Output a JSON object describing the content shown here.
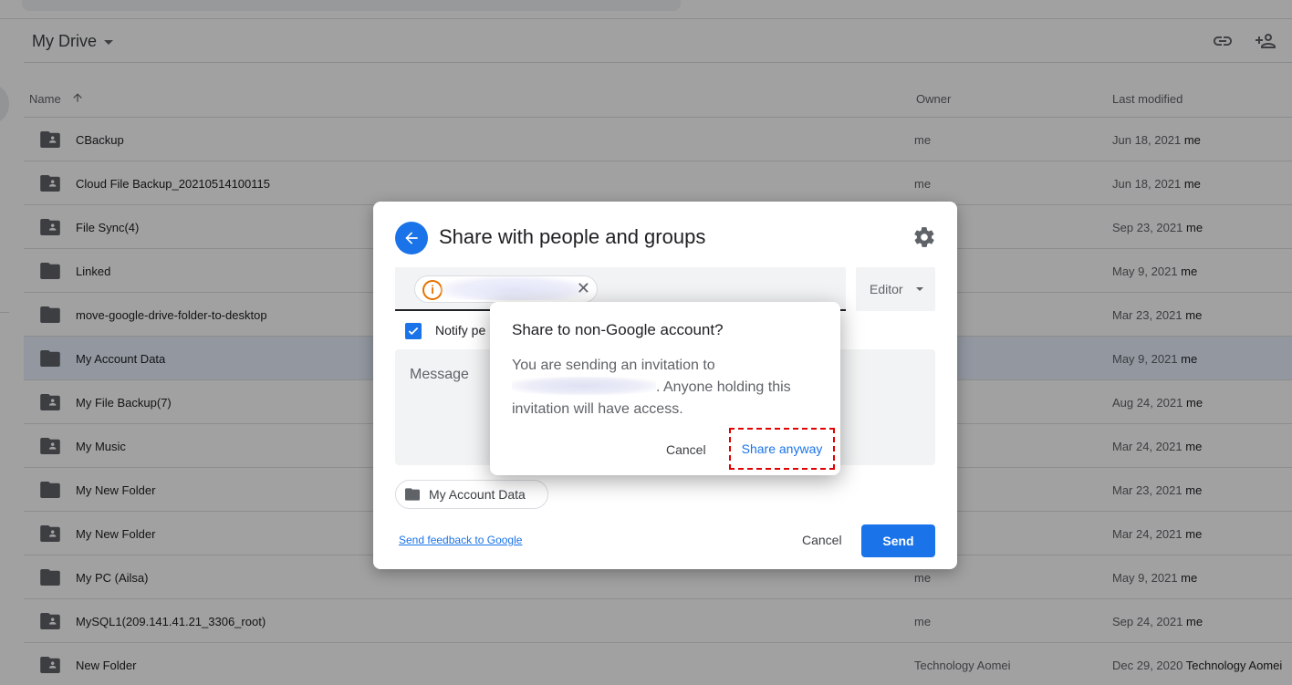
{
  "drive": {
    "title": "My Drive",
    "columns": {
      "name": "Name",
      "owner": "Owner",
      "modified": "Last modified"
    },
    "rows": [
      {
        "name": "CBackup",
        "owner": "me",
        "date": "Jun 18, 2021",
        "by": "me",
        "shared": true
      },
      {
        "name": "Cloud File Backup_20210514100115",
        "owner": "me",
        "date": "Jun 18, 2021",
        "by": "me",
        "shared": true
      },
      {
        "name": "File Sync(4)",
        "owner": "",
        "date": "Sep 23, 2021",
        "by": "me",
        "shared": true
      },
      {
        "name": "Linked",
        "owner": "",
        "date": "May 9, 2021",
        "by": "me",
        "shared": false
      },
      {
        "name": "move-google-drive-folder-to-desktop",
        "owner": "",
        "date": "Mar 23, 2021",
        "by": "me",
        "shared": false
      },
      {
        "name": "My Account Data",
        "owner": "",
        "date": "May 9, 2021",
        "by": "me",
        "shared": false,
        "selected": true
      },
      {
        "name": "My File Backup(7)",
        "owner": "",
        "date": "Aug 24, 2021",
        "by": "me",
        "shared": true
      },
      {
        "name": "My Music",
        "owner": "",
        "date": "Mar 24, 2021",
        "by": "me",
        "shared": true
      },
      {
        "name": "My New Folder",
        "owner": "",
        "date": "Mar 23, 2021",
        "by": "me",
        "shared": false
      },
      {
        "name": "My New Folder",
        "owner": "",
        "date": "Mar 24, 2021",
        "by": "me",
        "shared": true
      },
      {
        "name": "My PC (Ailsa)",
        "owner": "me",
        "date": "May 9, 2021",
        "by": "me",
        "shared": false
      },
      {
        "name": "MySQL1(209.141.41.21_3306_root)",
        "owner": "me",
        "date": "Sep 24, 2021",
        "by": "me",
        "shared": true
      },
      {
        "name": "New Folder",
        "owner": "Technology Aomei",
        "date": "Dec 29, 2020",
        "by": "Technology Aomei",
        "shared": true
      }
    ]
  },
  "share_dialog": {
    "title": "Share with people and groups",
    "role": "Editor",
    "notify_label": "Notify pe",
    "message_placeholder": "Message",
    "folder_chip": "My Account Data",
    "feedback_link": "Send feedback to Google",
    "cancel": "Cancel",
    "send": "Send"
  },
  "confirm_dialog": {
    "title": "Share to non-Google account?",
    "body_prefix": "You are sending an invitation to",
    "body_suffix": ". Anyone holding this invitation will have access.",
    "cancel": "Cancel",
    "confirm": "Share anyway"
  },
  "colors": {
    "accent": "#1a73e8",
    "highlight": "#e00000",
    "warning": "#e37400"
  }
}
